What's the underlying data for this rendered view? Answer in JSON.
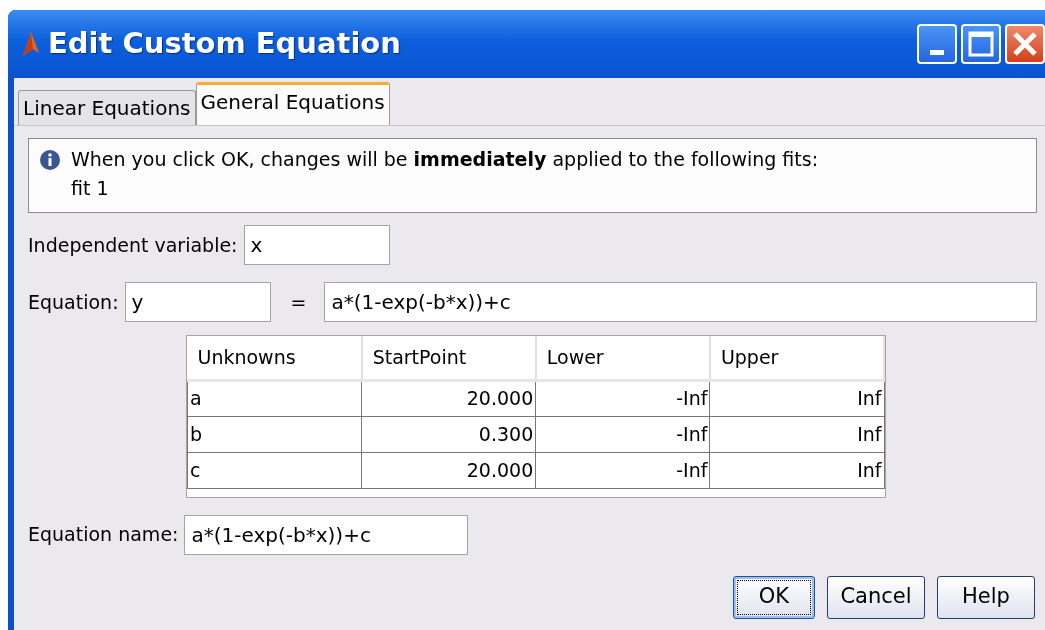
{
  "window": {
    "title": "Edit Custom Equation"
  },
  "tabs": [
    {
      "label": "Linear Equations",
      "selected": false
    },
    {
      "label": "General Equations",
      "selected": true
    }
  ],
  "info": {
    "text": "When you click OK, changes will be **immediately** applied to the following fits:",
    "fits": "fit 1"
  },
  "independent_variable": {
    "label": "Independent variable:",
    "value": "x"
  },
  "equation": {
    "label": "Equation:",
    "lhs": "y",
    "equals": "=",
    "rhs": "a*(1-exp(-b*x))+c"
  },
  "table": {
    "columns": [
      "Unknowns",
      "StartPoint",
      "Lower",
      "Upper"
    ],
    "rows": [
      [
        "a",
        "20.000",
        "-Inf",
        "Inf"
      ],
      [
        "b",
        "0.300",
        "-Inf",
        "Inf"
      ],
      [
        "c",
        "20.000",
        "-Inf",
        "Inf"
      ]
    ]
  },
  "equation_name": {
    "label": "Equation name:",
    "value": "a*(1-exp(-b*x))+c"
  },
  "buttons": [
    {
      "label": "OK",
      "focused": true
    },
    {
      "label": "Cancel",
      "focused": false
    },
    {
      "label": "Help",
      "focused": false
    }
  ]
}
